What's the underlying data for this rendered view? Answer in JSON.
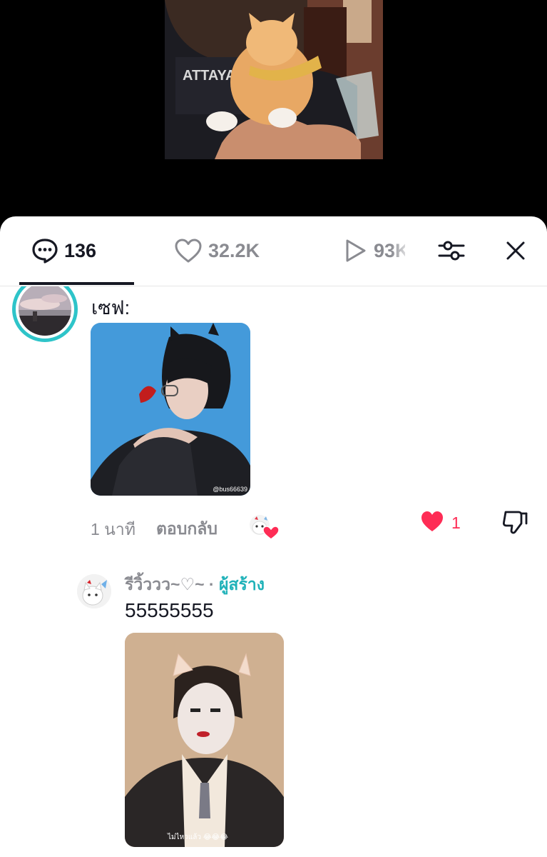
{
  "tabs": {
    "comments": {
      "icon": "comment-bubble-icon",
      "count": "136"
    },
    "likes": {
      "icon": "heart-outline-icon",
      "count": "32.2K"
    },
    "views": {
      "icon": "play-outline-icon",
      "count": "93K"
    },
    "filter_icon": "sliders-filter-icon",
    "close_icon": "close-x-icon"
  },
  "comments": [
    {
      "text": "เซฟ:",
      "image_watermark": "@bus66639",
      "time": "1 นาที",
      "reply_label": "ตอบกลับ",
      "like_count": "1",
      "liked": true
    },
    {
      "username": "รีวิ้ววว~♡~",
      "separator": "·",
      "creator_label": "ผู้สร้าง",
      "text": "55555555",
      "image_caption": "ไม่ไหวแล้ว 😂😂😂"
    }
  ],
  "colors": {
    "accent_like": "#fe2c55",
    "creator_teal": "#20b2b9",
    "avatar_ring": "#2ec4c9",
    "muted_text": "#8a8b91"
  }
}
